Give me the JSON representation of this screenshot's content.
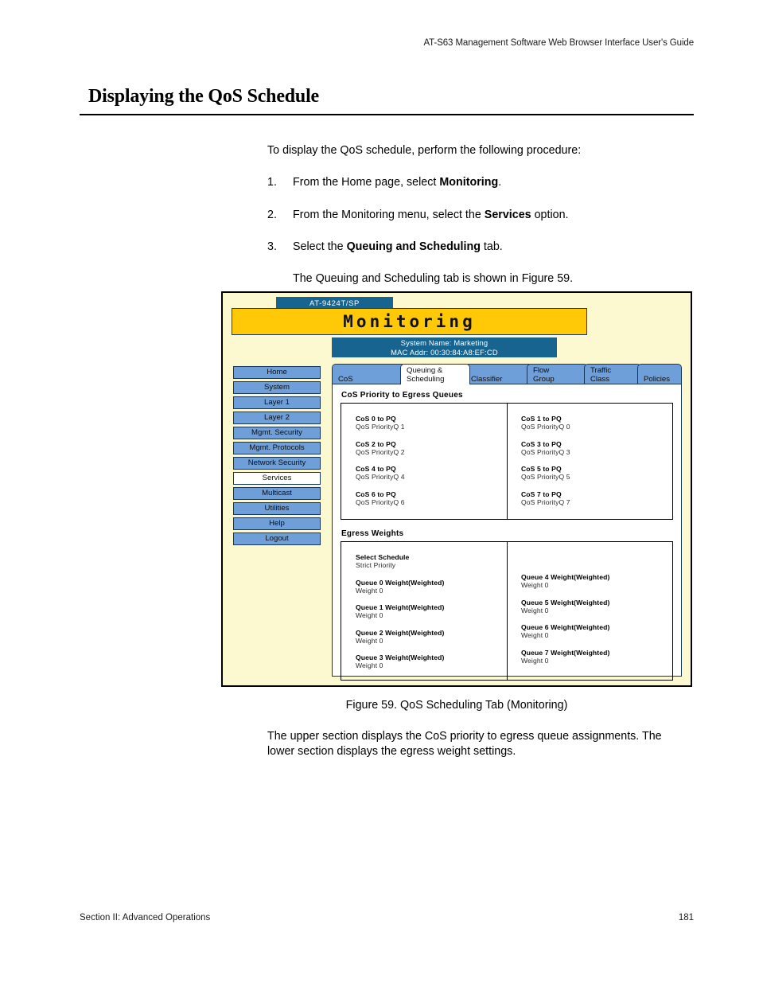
{
  "document": {
    "running_head": "AT-S63 Management Software Web Browser Interface User's Guide",
    "title": "Displaying the QoS Schedule",
    "lead": "To display the QoS schedule, perform the following procedure:",
    "steps": [
      {
        "num": "1.",
        "text_before": "From the Home page, select ",
        "bold": "Monitoring",
        "text_after": "."
      },
      {
        "num": "2.",
        "text_before": "From the Monitoring menu, select the ",
        "bold": "Services",
        "text_after": " option."
      },
      {
        "num": "3.",
        "text_before": "Select the ",
        "bold": "Queuing and Scheduling",
        "text_after": " tab."
      }
    ],
    "sub_note": "The Queuing and Scheduling tab is shown in Figure 59.",
    "caption": "Figure 59. QoS Scheduling Tab (Monitoring)",
    "after_text": "The upper section displays the CoS priority to egress queue assignments. The lower section displays the egress weight settings.",
    "footer_left": "Section II: Advanced Operations",
    "footer_page": "181"
  },
  "figure": {
    "device_tag": "AT-9424T/SP",
    "app_banner": "Monitoring",
    "system_name": "System Name: Marketing",
    "mac_addr": "MAC Addr: 00:30:84:A8:EF:CD",
    "nav": {
      "items": [
        {
          "label": "Home",
          "active": false
        },
        {
          "label": "System",
          "active": false
        },
        {
          "label": "Layer 1",
          "active": false
        },
        {
          "label": "Layer 2",
          "active": false
        },
        {
          "label": "Mgmt. Security",
          "active": false
        },
        {
          "label": "Mgmt. Protocols",
          "active": false
        },
        {
          "label": "Network Security",
          "active": false
        },
        {
          "label": "Services",
          "active": true
        },
        {
          "label": "Multicast",
          "active": false
        },
        {
          "label": "Utilities",
          "active": false
        },
        {
          "label": "Help",
          "active": false
        },
        {
          "label": "Logout",
          "active": false
        }
      ]
    },
    "tabs": [
      {
        "line1": "CoS",
        "line2": "",
        "active": false
      },
      {
        "line1": "Queuing &",
        "line2": "Scheduling",
        "active": true
      },
      {
        "line1": "Classifier",
        "line2": "",
        "active": false
      },
      {
        "line1": "Flow",
        "line2": "Group",
        "active": false
      },
      {
        "line1": "Traffic",
        "line2": "Class",
        "active": false
      },
      {
        "line1": "Policies",
        "line2": "",
        "active": false
      }
    ],
    "cos_section": {
      "title": "CoS Priority to Egress Queues",
      "left": [
        {
          "key": "CoS 0 to PQ",
          "value": "QoS PriorityQ 1"
        },
        {
          "key": "CoS 2 to PQ",
          "value": "QoS PriorityQ 2"
        },
        {
          "key": "CoS 4 to PQ",
          "value": "QoS PriorityQ 4"
        },
        {
          "key": "CoS 6 to PQ",
          "value": "QoS PriorityQ 6"
        }
      ],
      "right": [
        {
          "key": "CoS 1 to PQ",
          "value": "QoS PriorityQ 0"
        },
        {
          "key": "CoS 3 to PQ",
          "value": "QoS PriorityQ 3"
        },
        {
          "key": "CoS 5 to PQ",
          "value": "QoS PriorityQ 5"
        },
        {
          "key": "CoS 7 to PQ",
          "value": "QoS PriorityQ 7"
        }
      ]
    },
    "weights_section": {
      "title": "Egress Weights",
      "left": [
        {
          "key": "Select Schedule",
          "value": "Strict Priority"
        },
        {
          "key": "Queue 0 Weight(Weighted)",
          "value": "Weight 0"
        },
        {
          "key": "Queue 1 Weight(Weighted)",
          "value": "Weight 0"
        },
        {
          "key": "Queue 2 Weight(Weighted)",
          "value": "Weight 0"
        },
        {
          "key": "Queue 3 Weight(Weighted)",
          "value": "Weight 0"
        }
      ],
      "right": [
        {
          "key": "Queue 4 Weight(Weighted)",
          "value": "Weight 0"
        },
        {
          "key": "Queue 5 Weight(Weighted)",
          "value": "Weight 0"
        },
        {
          "key": "Queue 6 Weight(Weighted)",
          "value": "Weight 0"
        },
        {
          "key": "Queue 7 Weight(Weighted)",
          "value": "Weight 0"
        }
      ]
    },
    "colors": {
      "page_bg": "#fcf8cf",
      "banner": "#ffc907",
      "header_blue": "#16648f",
      "nav_blue": "#6f9fd8",
      "border": "#16355e"
    }
  }
}
